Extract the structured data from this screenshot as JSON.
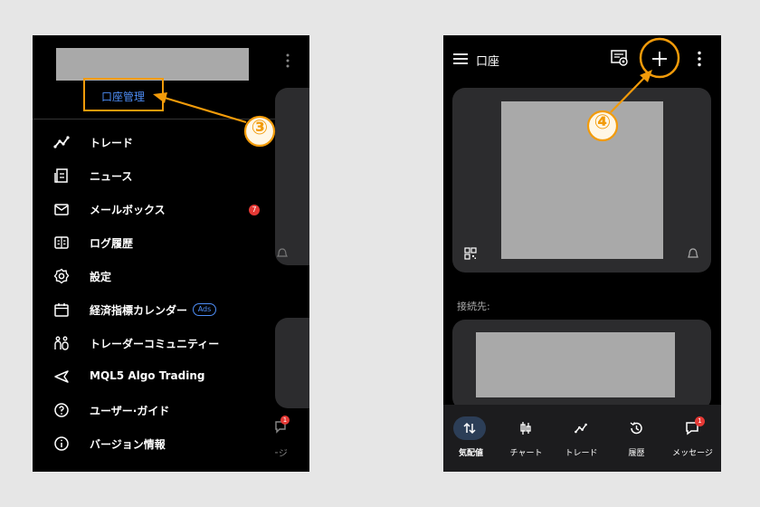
{
  "left_screen": {
    "account_manage": "口座管理",
    "menu": [
      {
        "icon": "trade-icon",
        "label": "トレード"
      },
      {
        "icon": "news-icon",
        "label": "ニュース"
      },
      {
        "icon": "mail-icon",
        "label": "メールボックス",
        "badge": "7"
      },
      {
        "icon": "journal-icon",
        "label": "ログ履歴"
      },
      {
        "icon": "gear-icon",
        "label": "設定"
      },
      {
        "icon": "calendar-icon",
        "label": "経済指標カレンダー",
        "tag": "Ads"
      },
      {
        "icon": "community-icon",
        "label": "トレーダーコミュニティー"
      },
      {
        "icon": "send-icon",
        "label": "MQL5 Algo Trading"
      },
      {
        "icon": "help-icon",
        "label": "ユーザー·ガイド"
      },
      {
        "icon": "info-icon",
        "label": "バージョン情報"
      }
    ],
    "peek_badge": "1",
    "peek_label": "ージ"
  },
  "right_screen": {
    "title": "口座",
    "connected_label": "接続先:",
    "nav": [
      {
        "icon": "quotes-icon",
        "label": "気配値"
      },
      {
        "icon": "chart-icon",
        "label": "チャート"
      },
      {
        "icon": "trade-icon",
        "label": "トレード"
      },
      {
        "icon": "history-icon",
        "label": "履歴"
      },
      {
        "icon": "messages-icon",
        "label": "メッセージ",
        "badge": "1"
      }
    ]
  },
  "annotations": {
    "step3": "③",
    "step4": "④"
  },
  "colors": {
    "accent": "#f29b0a",
    "link": "#4e8ef7",
    "badge": "#e53935"
  }
}
